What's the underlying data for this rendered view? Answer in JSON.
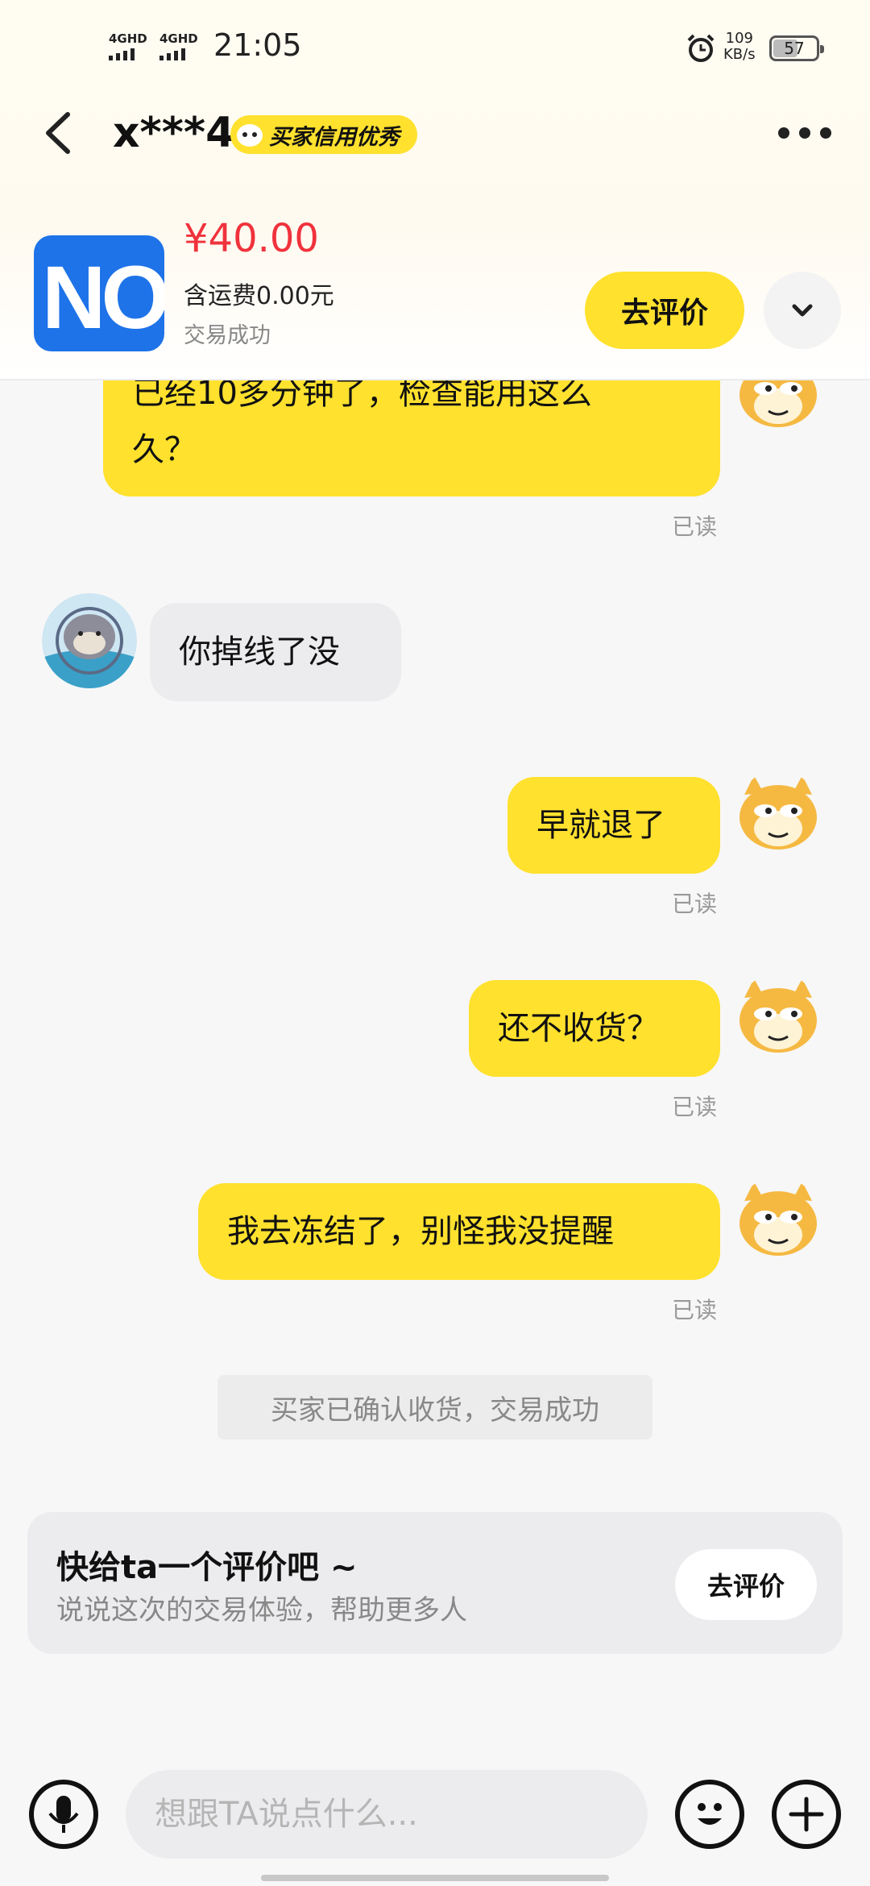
{
  "status_bar": {
    "signal1": "4GHD",
    "signal2": "4GHD",
    "time": "21:05",
    "speed_value": "109",
    "speed_unit": "KB/s",
    "battery": "57"
  },
  "header": {
    "title": "x***4",
    "badge": "买家信用优秀"
  },
  "product": {
    "logo_text": "NO",
    "price": "¥40.00",
    "shipping": "含运费0.00元",
    "status": "交易成功",
    "review_button": "去评价"
  },
  "messages": [
    {
      "from": "me",
      "lines": [
        "已经10多分钟了，检查能用这么",
        "久？"
      ],
      "status": "已读"
    },
    {
      "from": "them",
      "text": "你掉线了没"
    },
    {
      "from": "me",
      "text": "早就退了",
      "status": "已读"
    },
    {
      "from": "me",
      "text": "还不收货？",
      "status": "已读"
    },
    {
      "from": "me",
      "text": "我去冻结了，别怪我没提醒",
      "status": "已读"
    }
  ],
  "system_notice": "买家已确认收货，交易成功",
  "review_card": {
    "title": "快给ta一个评价吧 ~",
    "subtitle": "说说这次的交易体验，帮助更多人",
    "button": "去评价"
  },
  "input": {
    "placeholder": "想跟TA说点什么..."
  },
  "colors": {
    "accent_yellow": "#ffe12e",
    "price_red": "#f0323c"
  }
}
